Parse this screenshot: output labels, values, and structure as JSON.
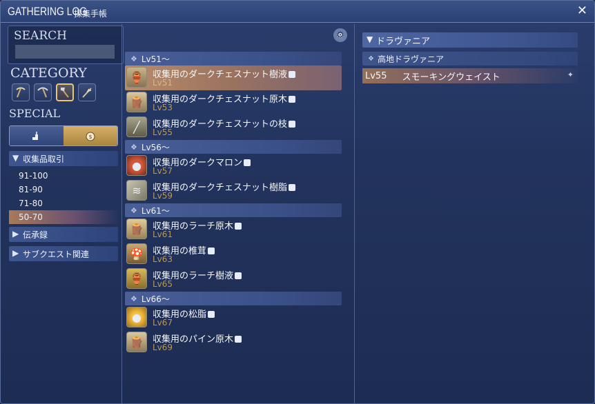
{
  "window": {
    "title": "GATHERING LOG",
    "subtitle": "採集手帳",
    "close_glyph": "✕"
  },
  "search": {
    "label": "SEARCH",
    "value": ""
  },
  "category": {
    "label": "CATEGORY",
    "icons": [
      {
        "name": "pickaxe-icon",
        "glyph": "⛏"
      },
      {
        "name": "quarrying-pick-icon",
        "glyph": "⛏"
      },
      {
        "name": "hatchet-icon",
        "glyph": "🪓",
        "active": true
      },
      {
        "name": "harvesting-icon",
        "glyph": "🌾"
      }
    ]
  },
  "special": {
    "label": "SPECIAL",
    "options": [
      {
        "name": "stairs-icon",
        "glyph": "▟"
      },
      {
        "name": "coin-bag-icon",
        "glyph": "◉"
      }
    ]
  },
  "tree": {
    "collectables": {
      "label": "収集品取引",
      "items": [
        "91-100",
        "81-90",
        "71-80",
        "50-70"
      ],
      "selected": "50-70"
    },
    "folklore": {
      "label": "伝承録"
    },
    "sidequests": {
      "label": "サブクエスト関連"
    }
  },
  "list": {
    "groups": [
      {
        "header": "Lv51～",
        "items": [
          {
            "name": "収集用のダークチェスナット樹液",
            "lv": "Lv51",
            "selected": true
          },
          {
            "name": "収集用のダークチェスナット原木",
            "lv": "Lv53"
          },
          {
            "name": "収集用のダークチェスナットの枝",
            "lv": "Lv55"
          }
        ]
      },
      {
        "header": "Lv56～",
        "items": [
          {
            "name": "収集用のダークマロン",
            "lv": "Lv57"
          },
          {
            "name": "収集用のダークチェスナット樹脂",
            "lv": "Lv59"
          }
        ]
      },
      {
        "header": "Lv61～",
        "items": [
          {
            "name": "収集用のラーチ原木",
            "lv": "Lv61"
          },
          {
            "name": "収集用の椎茸",
            "lv": "Lv63"
          },
          {
            "name": "収集用のラーチ樹液",
            "lv": "Lv65"
          }
        ]
      },
      {
        "header": "Lv66～",
        "items": [
          {
            "name": "収集用の松脂",
            "lv": "Lv67"
          },
          {
            "name": "収集用のパイン原木",
            "lv": "Lv69"
          }
        ]
      }
    ]
  },
  "detail": {
    "region": "ドラヴァニア",
    "area": "高地ドラヴァニア",
    "node": {
      "lv": "Lv55",
      "name": "スモーキングウェイスト"
    }
  },
  "colors": {
    "accent_gold": "#d6b066",
    "selected_row": "#b98c68",
    "panel_blue": "#2a3e6e",
    "level_text": "#b89858"
  }
}
